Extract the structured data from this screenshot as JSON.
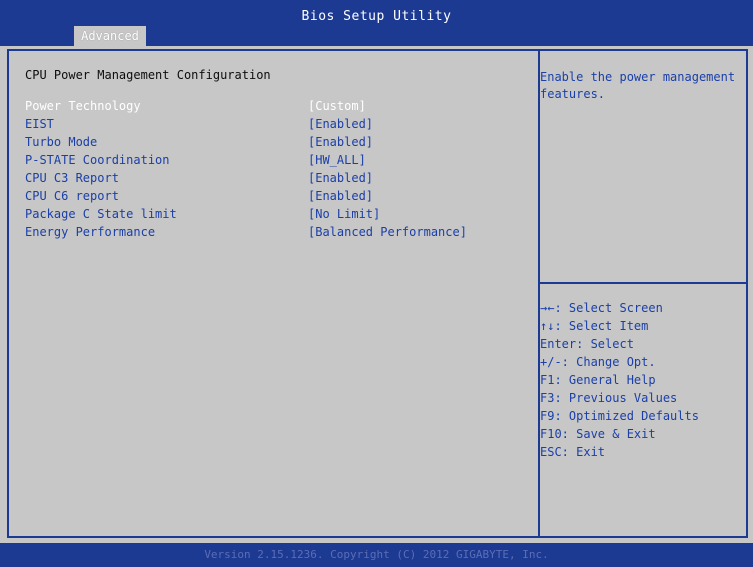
{
  "header": {
    "title": "Bios Setup Utility",
    "tab": "Advanced"
  },
  "main": {
    "section_title": "CPU Power Management Configuration",
    "settings": [
      {
        "label": "Power Technology",
        "value": "[Custom]"
      },
      {
        "label": "EIST",
        "value": "[Enabled]"
      },
      {
        "label": "Turbo Mode",
        "value": "[Enabled]"
      },
      {
        "label": "P-STATE Coordination",
        "value": "[HW_ALL]"
      },
      {
        "label": "CPU C3 Report",
        "value": "[Enabled]"
      },
      {
        "label": "CPU C6 report",
        "value": "[Enabled]"
      },
      {
        "label": "Package C State limit",
        "value": "[No Limit]"
      },
      {
        "label": "Energy Performance",
        "value": "[Balanced Performance]"
      }
    ]
  },
  "help": {
    "description": "Enable the power management features.",
    "keys": [
      "→←: Select Screen",
      "↑↓: Select Item",
      "Enter: Select",
      "+/-: Change Opt.",
      "F1: General Help",
      "F3: Previous Values",
      "F9: Optimized Defaults",
      "F10: Save & Exit",
      "ESC: Exit"
    ]
  },
  "footer": {
    "text": "Version 2.15.1236. Copyright (C) 2012 GIGABYTE, Inc."
  },
  "colors": {
    "background": "#c7c7c7",
    "bar": "#1d3a93",
    "item_text": "#1a3fa8",
    "selected_text": "#ffffff"
  }
}
